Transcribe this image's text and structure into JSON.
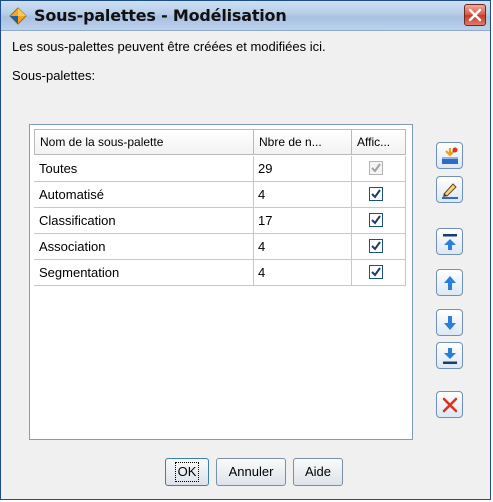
{
  "window": {
    "title": "Sous-palettes - Modélisation"
  },
  "description": "Les sous-palettes peuvent être créées et modifiées ici.",
  "list_label": "Sous-palettes:",
  "table": {
    "columns": [
      "Nom de la sous-palette",
      "Nbre de n...",
      "Affic..."
    ],
    "rows": [
      {
        "name": "Toutes",
        "count": "29",
        "shown": true,
        "enabled": false
      },
      {
        "name": "Automatisé",
        "count": "4",
        "shown": true,
        "enabled": true
      },
      {
        "name": "Classification",
        "count": "17",
        "shown": true,
        "enabled": true
      },
      {
        "name": "Association",
        "count": "4",
        "shown": true,
        "enabled": true
      },
      {
        "name": "Segmentation",
        "count": "4",
        "shown": true,
        "enabled": true
      }
    ]
  },
  "side_buttons": [
    "add-subpalette-icon",
    "edit-subpalette-icon",
    "move-top-icon",
    "move-up-icon",
    "move-down-icon",
    "move-bottom-icon",
    "delete-icon"
  ],
  "footer": {
    "ok": "OK",
    "cancel": "Annuler",
    "help": "Aide"
  },
  "colors": {
    "title_bar": "#b6cde9",
    "close_button": "#d9553f",
    "arrow_blue": "#2a7fd8",
    "delete_red": "#e0311b"
  }
}
